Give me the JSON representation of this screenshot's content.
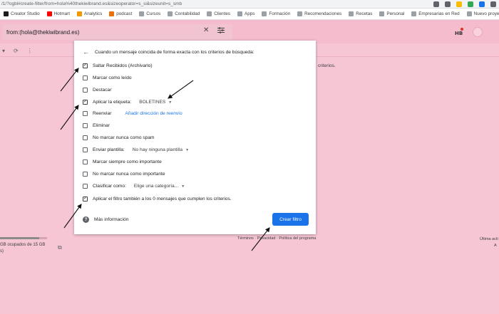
{
  "browser": {
    "url": "/1/?ogbl#create-filter/from=hola%40thekiwibrand.es&sizeoperator=s_si&sizeunit=s_smb",
    "bookmarks": [
      {
        "label": "Creator Studio",
        "color": "#1c1c1c"
      },
      {
        "label": "Hotmart",
        "color": "#ff0000"
      },
      {
        "label": "Analytics",
        "color": "#f29900"
      },
      {
        "label": "podcast",
        "color": "#e8710a"
      },
      {
        "label": "Cursos",
        "color": "#9aa0a6"
      },
      {
        "label": "Contabilidad",
        "color": "#9aa0a6"
      },
      {
        "label": "Clientes",
        "color": "#9aa0a6"
      },
      {
        "label": "Apps",
        "color": "#9aa0a6"
      },
      {
        "label": "Formación",
        "color": "#9aa0a6"
      },
      {
        "label": "Recomendaciones",
        "color": "#9aa0a6"
      },
      {
        "label": "Recetas",
        "color": "#9aa0a6"
      },
      {
        "label": "Personal",
        "color": "#9aa0a6"
      },
      {
        "label": "Empresarias en Red",
        "color": "#9aa0a6"
      },
      {
        "label": "Nuevo proyecto",
        "color": "#9aa0a6"
      }
    ]
  },
  "header": {
    "search_value": "from:(hola@thekiwibrand.es)",
    "logo_text": "HB",
    "logo_badge": "1"
  },
  "background": {
    "criteria_text": "criterios.",
    "storage_text": "GB ocupados de 15 GB",
    "storage_text2": "s)",
    "storage_fraction": 0.83,
    "footer_links": "Términos · Privacidad · Política del programa",
    "footer_right1": "Última acti",
    "footer_right2": "A"
  },
  "dialog": {
    "heading": "Cuando un mensaje coincida de forma exacta con los criterios de búsqueda:",
    "options": [
      {
        "label": "Saltar Recibidos (Archivarlo)",
        "checked": true
      },
      {
        "label": "Marcar como leído",
        "checked": false
      },
      {
        "label": "Destacar",
        "checked": false
      },
      {
        "label": "Aplicar la etiqueta:",
        "checked": true,
        "select": "BOLETINES"
      },
      {
        "label": "Reenviar",
        "checked": false,
        "link": "Añadir dirección de reenvío"
      },
      {
        "label": "Eliminar",
        "checked": false
      },
      {
        "label": "No marcar nunca como spam",
        "checked": false
      },
      {
        "label": "Enviar plantilla:",
        "checked": false,
        "select": "No hay ninguna plantilla"
      },
      {
        "label": "Marcar siempre como importante",
        "checked": false
      },
      {
        "label": "No marcar nunca como importante",
        "checked": false
      },
      {
        "label": "Clasificar como:",
        "checked": false,
        "select": "Elige una categoría..."
      },
      {
        "label": "Aplicar el filtro también a los 0 mensajes que cumplen los criterios.",
        "checked": true
      }
    ],
    "more_info": "Más información",
    "create_button": "Crear filtro"
  }
}
